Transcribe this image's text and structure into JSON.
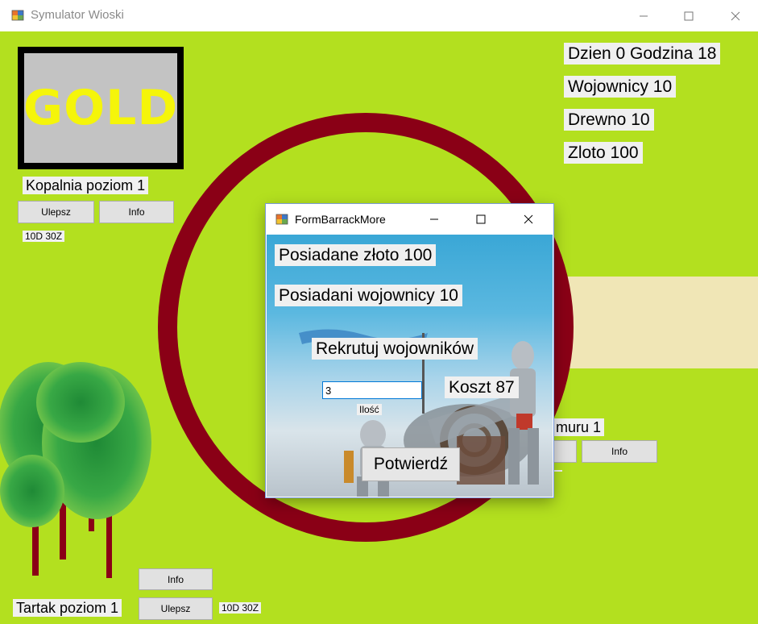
{
  "window": {
    "title": "Symulator Wioski"
  },
  "stats": {
    "day_hour": "Dzien 0 Godzina 18",
    "warriors": "Wojownicy 10",
    "wood": "Drewno 10",
    "gold": "Zloto 100"
  },
  "mine": {
    "image_text": "GOLD",
    "level_label": "Kopalnia poziom 1",
    "upgrade_label": "Ulepsz",
    "info_label": "Info",
    "cost": "10D  30Z"
  },
  "wall": {
    "level_label_partial": "muru 1",
    "info_label": "Info"
  },
  "sawmill": {
    "level_label": "Tartak poziom 1",
    "upgrade_label": "Ulepsz",
    "info_label": "Info",
    "cost": "10D  30Z"
  },
  "dialog": {
    "title": "FormBarrackMore",
    "owned_gold": "Posiadane złoto 100",
    "owned_warriors": "Posiadani wojownicy 10",
    "recruit_label": "Rekrutuj wojowników",
    "quantity_value": "3",
    "quantity_label": "Ilość",
    "cost_label": "Koszt 87",
    "confirm_label": "Potwierdź"
  },
  "colors": {
    "grass": "#b3e01f",
    "ring": "#8a0016",
    "road": "#f0e6b6",
    "gold_text": "#f5f50a",
    "tree_leaves": "#2e9e3a",
    "tree_trunk": "#8a0016"
  }
}
